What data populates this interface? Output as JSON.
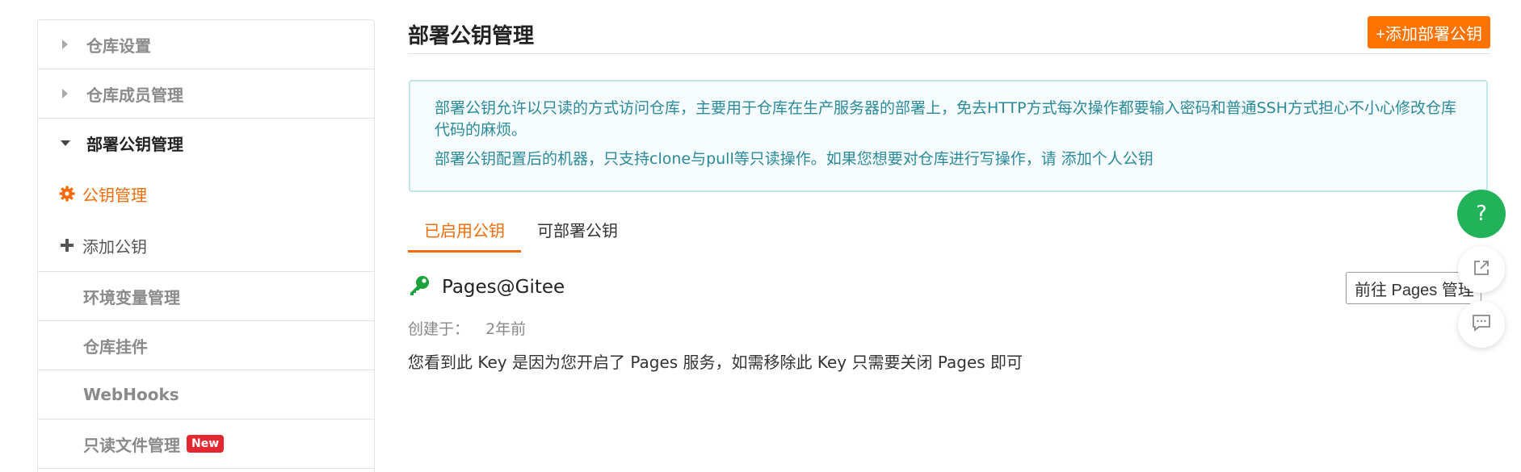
{
  "sidebar": {
    "items": [
      {
        "label": "仓库设置"
      },
      {
        "label": "仓库成员管理"
      },
      {
        "label": "部署公钥管理"
      },
      {
        "label": "环境变量管理"
      },
      {
        "label": "仓库挂件"
      },
      {
        "label": "WebHooks"
      },
      {
        "label": "只读文件管理",
        "badge": "New"
      }
    ],
    "sub_items": [
      {
        "label": "公钥管理"
      },
      {
        "label": "添加公钥"
      }
    ]
  },
  "main": {
    "title": "部署公钥管理",
    "add_button": "+添加部署公钥",
    "info": {
      "line1": "部署公钥允许以只读的方式访问仓库，主要用于仓库在生产服务器的部署上，免去HTTP方式每次操作都要输入密码和普通SSH方式担心不小心修改仓库代码的麻烦。",
      "line2": "部署公钥配置后的机器，只支持clone与pull等只读操作。如果您想要对仓库进行写操作，请 添加个人公钥"
    },
    "tabs": [
      {
        "label": "已启用公钥"
      },
      {
        "label": "可部署公钥"
      }
    ],
    "key": {
      "name": "Pages@Gitee",
      "created_label": "创建于：",
      "created_value": "2年前",
      "description": "您看到此 Key 是因为您开启了 Pages 服务，如需移除此 Key 只需要关闭 Pages 即可",
      "goto_button": "前往 Pages 管理"
    }
  },
  "float": {
    "help": "?"
  },
  "colors": {
    "accent": "#fe7300",
    "help_green": "#22b35a",
    "info_text": "#2a8a99",
    "key_green": "#1aa33b"
  }
}
